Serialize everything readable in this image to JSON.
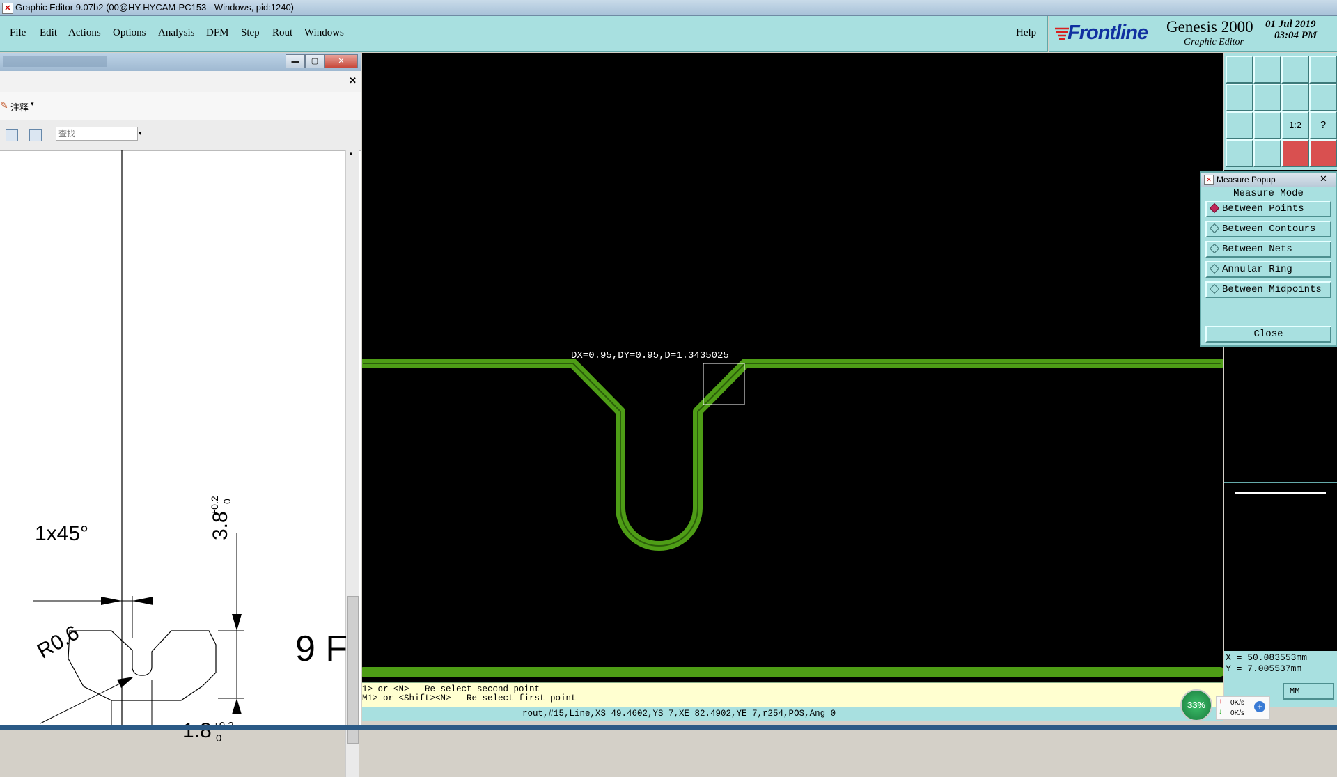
{
  "window": {
    "title": "Graphic Editor 9.07b2 (00@HY-HYCAM-PC153 - Windows, pid:1240)"
  },
  "menubar": {
    "items": [
      "File",
      "Edit",
      "Actions",
      "Options",
      "Analysis",
      "DFM",
      "Step",
      "Rout",
      "Windows"
    ],
    "help": "Help"
  },
  "brand": {
    "logo": "Frontline",
    "product": "Genesis 2000",
    "subtitle": "Graphic Editor",
    "date": "01 Jul 2019",
    "time": "03:04 PM"
  },
  "doc_panel": {
    "annot_label": "注释",
    "search_placeholder": "查找",
    "drawing": {
      "chamfer": "1x45°",
      "depth": "3.8",
      "depth_tol_upper": "+0.2",
      "depth_tol_lower": "0",
      "radius": "R0.6",
      "width": "1.8",
      "width_tol_upper": "+0.2",
      "width_tol_lower": "0",
      "partial": "9 F"
    }
  },
  "canvas": {
    "measure_readout": "DX=0.95,DY=0.95,D=1.3435025"
  },
  "measure_popup": {
    "title": "Measure Popup",
    "header": "Measure Mode",
    "options": [
      "Between Points",
      "Between Contours",
      "Between Nets",
      "Annular Ring",
      "Between Midpoints"
    ],
    "selected": "Between Points",
    "close_label": "Close"
  },
  "toolbar_icons": [
    "move-up-icon",
    "move-down-icon",
    "home-icon",
    "split-view-icon",
    "move-left-icon",
    "move-right-icon",
    "shift-left-icon",
    "shift-right-icon",
    "fit-all-icon",
    "fit-height-icon",
    "one-to-one-icon",
    "help-icon",
    "edit-tool-icon",
    "pin-icon",
    "rout-tool-icon",
    "net-tool-icon"
  ],
  "command_area": {
    "line1": "1> or <N> - Re-select second point",
    "line2": "M1> or <Shift><N> - Re-select first point"
  },
  "statusbar": {
    "text": "rout,#15,Line,XS=49.4602,YS=7,XE=82.4902,YE=7,r254,POS,Ang=0"
  },
  "coords": {
    "x": "X  = 50.083553mm",
    "y": "Y  = 7.005537mm"
  },
  "units": "MM",
  "net_meter": {
    "percent": "33%",
    "up": "0K/s",
    "down": "0K/s"
  }
}
